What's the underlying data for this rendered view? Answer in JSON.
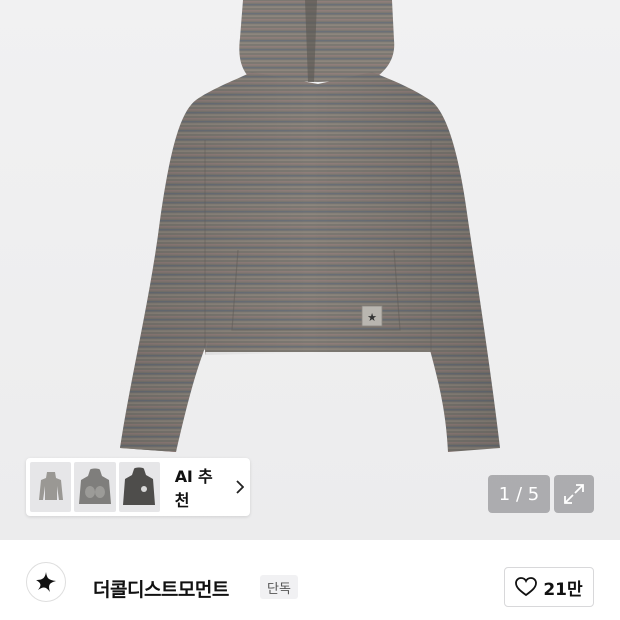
{
  "product": {
    "image_alt": "striped hooded long sleeve top"
  },
  "gallery": {
    "counter": "1 / 5",
    "current": 1,
    "total": 5
  },
  "ai_recommend": {
    "label": "AI 추천",
    "thumb_count": 3
  },
  "brand": {
    "name": "더콜디스트모먼트",
    "badge": "단독"
  },
  "like": {
    "count": "21만",
    "icon": "heart-outline-icon"
  },
  "colors": {
    "hero_bg": "#eeeeef",
    "overlay": "#78787c",
    "badge_bg": "#f1f1f3"
  }
}
